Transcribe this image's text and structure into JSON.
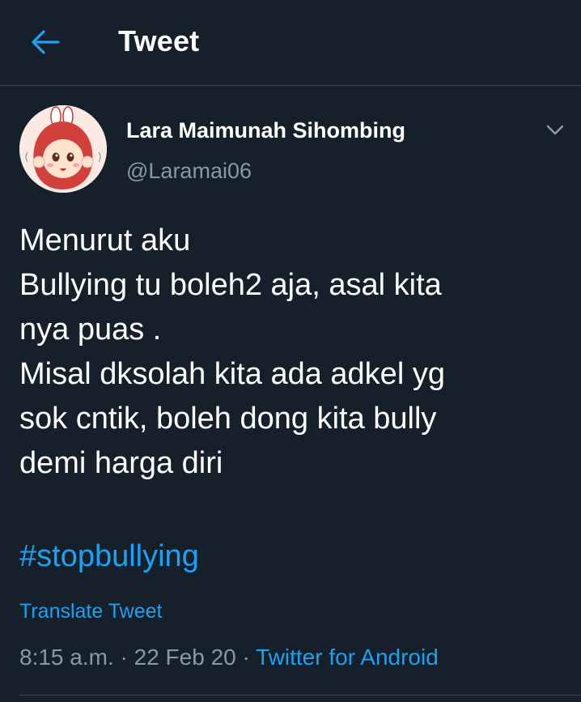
{
  "header": {
    "title": "Tweet",
    "back_icon": "arrow-left-icon"
  },
  "author": {
    "name": "Lara Maimunah Sihombing",
    "handle": "@Laramai06",
    "avatar": "avatar-illustration"
  },
  "tweet": {
    "lines": [
      "Menurut aku",
      "Bullying tu boleh2 aja, asal kita",
      "nya puas .",
      "Misal dksolah kita ada adkel yg",
      "sok cntik, boleh dong kita bully",
      "demi harga diri"
    ],
    "hashtag": "#stopbullying",
    "translate_label": "Translate Tweet"
  },
  "meta": {
    "time": "8:15 a.m.",
    "separator": "·",
    "date": "22 Feb 20",
    "source": "Twitter for Android"
  },
  "colors": {
    "background": "#15202b",
    "accent": "#1da1f2",
    "muted": "#8899a6",
    "divider": "#38444d"
  }
}
